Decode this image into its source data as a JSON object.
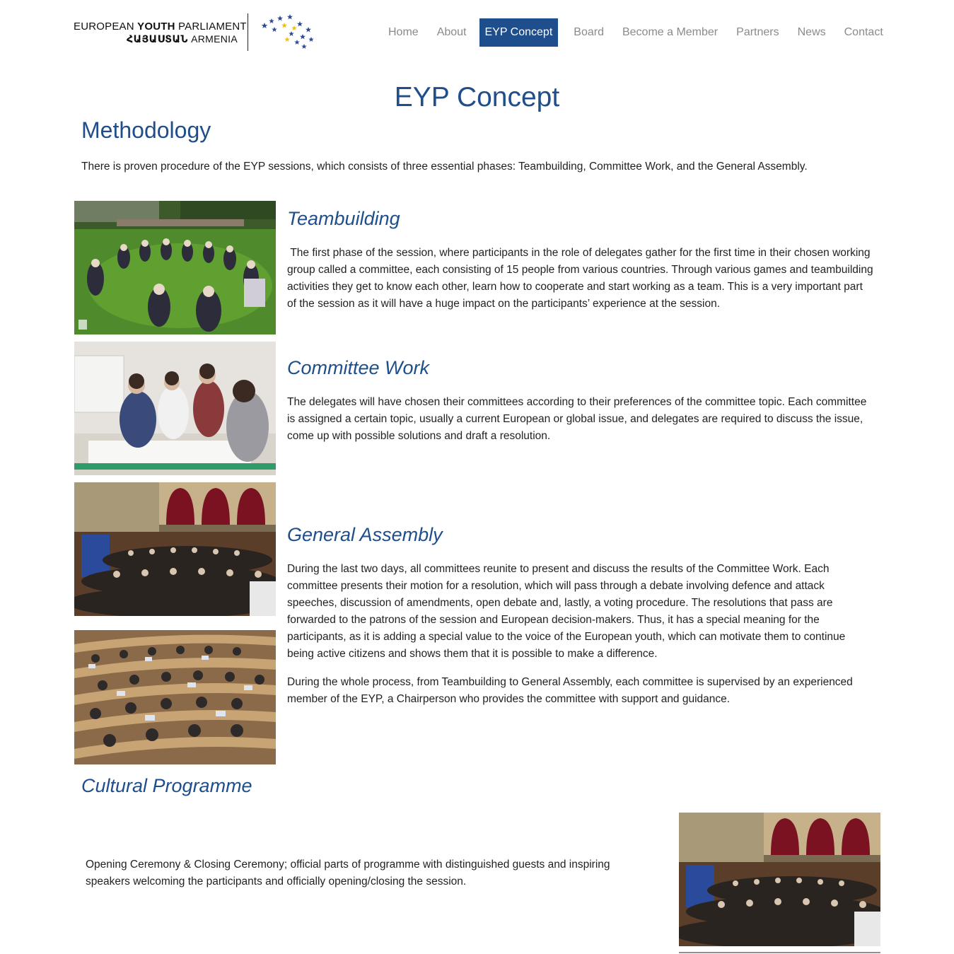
{
  "header": {
    "logo": {
      "line1_regular": "EUROPEAN",
      "line1_bold": "YOUTH",
      "line1_end": "PARLIAMENT",
      "line2_bold": "ՀԱՅԱՍՏԱՆ",
      "line2_regular": "ARMENIA",
      "icon": "eu-stars-logo-icon"
    },
    "nav": [
      {
        "label": "Home"
      },
      {
        "label": "About"
      },
      {
        "label": "EYP Concept",
        "active": true
      },
      {
        "label": "Board"
      },
      {
        "label": "Become a Member"
      },
      {
        "label": "Partners"
      },
      {
        "label": "News"
      },
      {
        "label": "Contact"
      }
    ]
  },
  "main": {
    "title": "EYP Concept",
    "methodology": {
      "heading": "Methodology",
      "intro": "There is proven procedure of the EYP sessions, which consists of three essential phases: Teambuilding, Committee Work, and the General Assembly."
    },
    "phases": [
      {
        "title": "Teambuilding",
        "text": " The first phase of the session, where participants in the role of delegates gather for the first time in their chosen working group called a committee, each consisting of 15 people from various countries. Through various games and teambuilding activities they get to know each other, learn how to cooperate and start working as a team. This is a very important part of the session as it will have a huge impact on the participants’ experience at the session."
      },
      {
        "title": "Committee Work",
        "text": "The delegates will have chosen their committees according to their preferences of the committee topic. Each committee is assigned a certain topic, usually a current European or global issue, and delegates are required to discuss the issue, come up with possible solutions and draft a resolution."
      },
      {
        "title": "General Assembly",
        "text": "During the last two days, all committees reunite to present and discuss the results of the Committee Work. Each committee presents their motion for a resolution, which will pass through a debate involving defence and attack speeches, discussion of amendments, open debate and, lastly, a voting procedure. The resolutions that pass are forwarded to the patrons of the session and European decision-makers. Thus, it has a special meaning for the participants, as it is adding a special value to the voice of the European youth, which can motivate them to continue being active citizens and shows them that it is possible to make a difference.",
        "text2": "During the whole process, from Teambuilding to General Assembly, each committee is supervised by an experienced member of the EYP, a Chairperson who provides the committee with support and guidance."
      }
    ],
    "cultural": {
      "title": "Cultural Programme",
      "text": "Opening Ceremony & Closing Ceremony; official parts of programme with distinguished guests and inspiring speakers welcoming the participants and officially opening/closing the session."
    },
    "photos": [
      {
        "name": "teambuilding-photo"
      },
      {
        "name": "committee-work-photo"
      },
      {
        "name": "general-assembly-hall-photo"
      },
      {
        "name": "general-assembly-seats-photo"
      },
      {
        "name": "cultural-programme-photo"
      }
    ]
  },
  "colors": {
    "brand": "#1f4e8c",
    "nav_text": "#8a8a8a",
    "body_text": "#222222"
  }
}
